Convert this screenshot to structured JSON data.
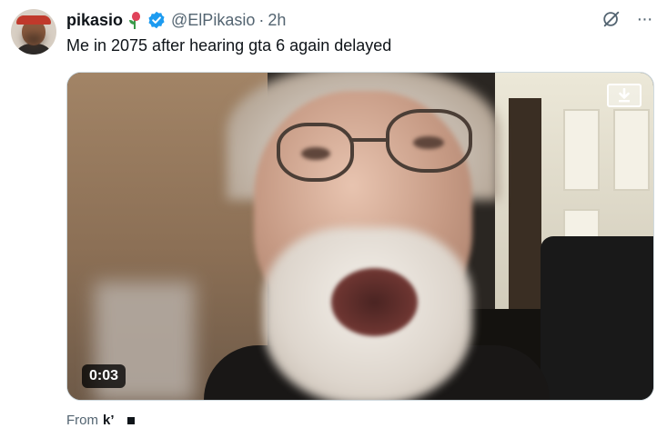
{
  "tweet": {
    "author": {
      "name": "pikasio",
      "handle": "@ElPikasio",
      "separator": "·",
      "time": "2h",
      "avatar_icon": "avatar-icon",
      "badges": [
        "rose-icon",
        "verified-icon"
      ]
    },
    "text": "Me in 2075 after hearing gta 6 again delayed",
    "actions": {
      "grok_icon": "grok-icon",
      "more_label": "···"
    },
    "media": {
      "duration": "0:03",
      "download_icon": "download-icon"
    },
    "attribution": {
      "prefix": "From",
      "source": "k’"
    },
    "colors": {
      "text": "#0f1419",
      "muted": "#536471",
      "verified": "#1d9bf0",
      "border": "#cfd9de"
    }
  }
}
